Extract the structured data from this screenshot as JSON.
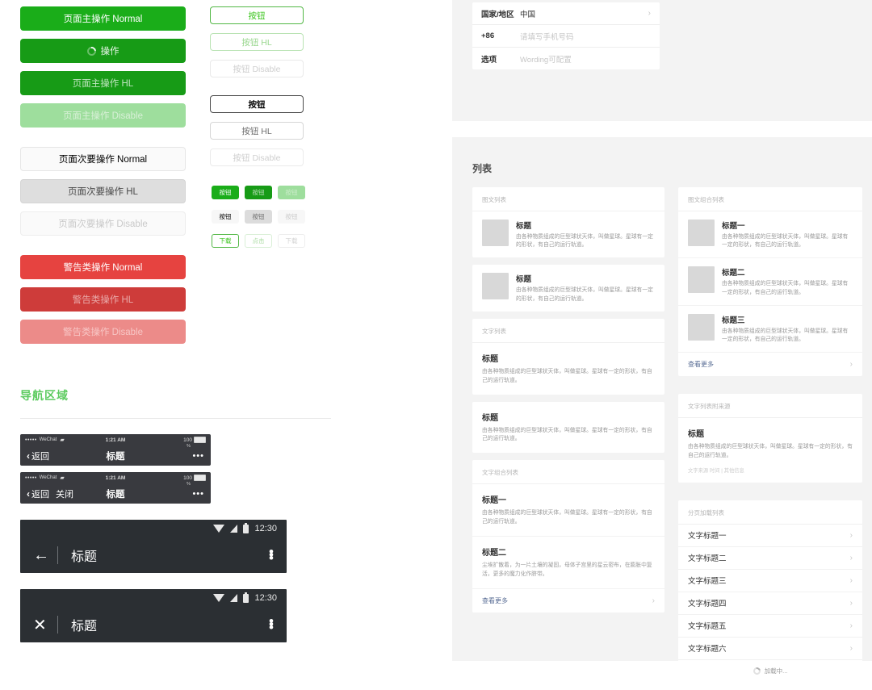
{
  "buttons": {
    "primary": [
      {
        "label": "页面主操作 Normal",
        "state": "normal"
      },
      {
        "label": "操作",
        "state": "loading"
      },
      {
        "label": "页面主操作 HL",
        "state": "hl"
      },
      {
        "label": "页面主操作 Disable",
        "state": "disable"
      }
    ],
    "secondary": [
      {
        "label": "页面次要操作 Normal",
        "state": "normal"
      },
      {
        "label": "页面次要操作 HL",
        "state": "hl"
      },
      {
        "label": "页面次要操作 Disable",
        "state": "disable"
      }
    ],
    "warn": [
      {
        "label": "警告类操作 Normal",
        "state": "normal"
      },
      {
        "label": "警告类操作 HL",
        "state": "hl"
      },
      {
        "label": "警告类操作 Disable",
        "state": "disable"
      }
    ],
    "outline_green": [
      {
        "label": "按钮",
        "state": "normal"
      },
      {
        "label": "按钮 HL",
        "state": "hl"
      },
      {
        "label": "按钮 Disable",
        "state": "disable"
      }
    ],
    "outline_dark": [
      {
        "label": "按钮",
        "state": "normal"
      },
      {
        "label": "按钮 HL",
        "state": "hl"
      },
      {
        "label": "按钮 Disable",
        "state": "disable"
      }
    ],
    "mini_green": [
      {
        "label": "按钮"
      },
      {
        "label": "按钮"
      },
      {
        "label": "按钮"
      }
    ],
    "mini_gray": [
      {
        "label": "按钮"
      },
      {
        "label": "按钮"
      },
      {
        "label": "按钮"
      }
    ],
    "mini_outline": [
      {
        "label": "下载"
      },
      {
        "label": "点击"
      },
      {
        "label": "下载"
      }
    ]
  },
  "nav": {
    "section_title": "导航区域",
    "ios": [
      {
        "carrier": "WeChat",
        "time": "1:21 AM",
        "battery": "100",
        "battery_unit": "%",
        "back": "返回",
        "close": "",
        "title": "标题",
        "more": "•••"
      },
      {
        "carrier": "WeChat",
        "time": "1:21 AM",
        "battery": "100",
        "battery_unit": "%",
        "back": "返回",
        "close": "关闭",
        "title": "标题",
        "more": "•••"
      }
    ],
    "android": [
      {
        "time": "12:30",
        "icon": "back-arrow",
        "title": "标题"
      },
      {
        "time": "12:30",
        "icon": "close",
        "title": "标题"
      }
    ]
  },
  "form": {
    "rows": [
      {
        "label": "国家/地区",
        "value": "中国",
        "placeholder": "",
        "chevron": "›"
      },
      {
        "label": "+86",
        "value": "",
        "placeholder": "请填写手机号码",
        "chevron": ""
      },
      {
        "label": "选项",
        "value": "",
        "placeholder": "Wording可配置",
        "chevron": ""
      }
    ]
  },
  "list": {
    "heading": "列表",
    "media_list": {
      "caption": "图文列表",
      "items": [
        {
          "title": "标题",
          "desc": "由各种物质组成的巨型球状天体，叫做星球。星球有一定的形状，有自己的运行轨道。"
        },
        {
          "title": "标题",
          "desc": "由各种物质组成的巨型球状天体，叫做星球。星球有一定的形状，有自己的运行轨道。"
        }
      ]
    },
    "text_list": {
      "caption": "文字列表",
      "items": [
        {
          "title": "标题",
          "desc": "由各种物质组成的巨型球状天体，叫做星球。星球有一定的形状，有自己的运行轨道。"
        },
        {
          "title": "标题",
          "desc": "由各种物质组成的巨型球状天体，叫做星球。星球有一定的形状，有自己的运行轨道。"
        }
      ]
    },
    "text_combo_list": {
      "caption": "文字组合列表",
      "items": [
        {
          "title": "标题一",
          "desc": "由各种物质组成的巨型球状天体，叫做星球。星球有一定的形状，有自己的运行轨道。"
        },
        {
          "title": "标题二",
          "desc": "尘埃扩散着，为一片土壤的凝固，母体子宫里的星云密布，在膨胀中复活，更多的魔力化作脐带。"
        }
      ],
      "more": "查看更多",
      "more_chevron": "›"
    },
    "media_combo_list": {
      "caption": "图文组合列表",
      "items": [
        {
          "title": "标题一",
          "desc": "由各种物质组成的巨型球状天体，叫做星球。星球有一定的形状，有自己的运行轨道。"
        },
        {
          "title": "标题二",
          "desc": "由各种物质组成的巨型球状天体，叫做星球。星球有一定的形状，有自己的运行轨道。"
        },
        {
          "title": "标题三",
          "desc": "由各种物质组成的巨型球状天体，叫做星球。星球有一定的形状，有自己的运行轨道。"
        }
      ],
      "more": "查看更多",
      "more_chevron": "›"
    },
    "source_list": {
      "caption": "文字列表附来源",
      "title": "标题",
      "desc": "由各种物质组成的巨型球状天体，叫做星球。星球有一定的形状，有自己的运行轨道。",
      "meta": "文字来源 时间 | 其他信息"
    },
    "paged_list": {
      "caption": "分页加载列表",
      "items": [
        {
          "label": "文字标题一",
          "chevron": "›"
        },
        {
          "label": "文字标题二",
          "chevron": "›"
        },
        {
          "label": "文字标题三",
          "chevron": "›"
        },
        {
          "label": "文字标题四",
          "chevron": "›"
        },
        {
          "label": "文字标题五",
          "chevron": "›"
        },
        {
          "label": "文字标题六",
          "chevron": "›"
        }
      ],
      "loading": "加载中..."
    }
  },
  "colors": {
    "brand_green": "#1aad19",
    "brand_green_hl": "#179b16",
    "brand_green_disable": "#9ede9d",
    "warn_red": "#e64340",
    "warn_red_hl": "#ce3c3a",
    "warn_red_disable": "#ec8b89",
    "link_blue": "#586c94",
    "panel_bg": "#f3f3f3"
  }
}
